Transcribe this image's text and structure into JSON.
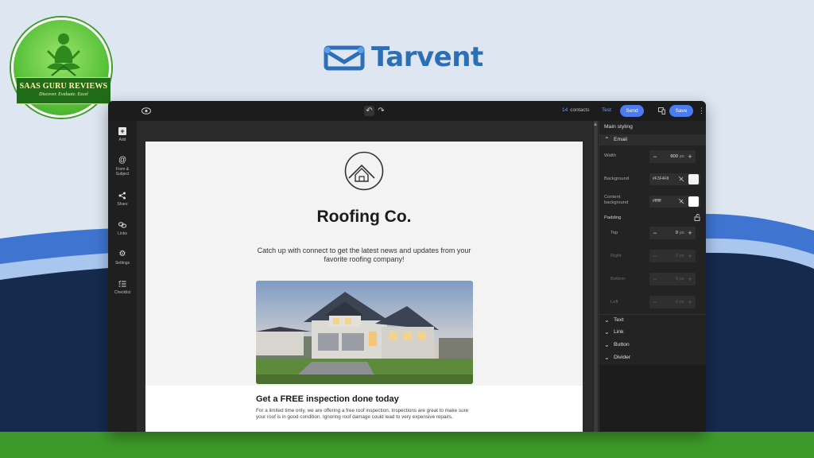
{
  "badge": {
    "title": "SAAS GURU REVIEWS",
    "tagline": "Discover. Evaluate. Excel"
  },
  "brand": {
    "name": "Tarvent"
  },
  "topbar": {
    "contacts_count": "14",
    "contacts_label": "contacts",
    "test_label": "Test",
    "send_label": "Send",
    "save_label": "Save"
  },
  "rail": {
    "items": [
      {
        "label": "Add",
        "icon": "plus-icon"
      },
      {
        "label": "From &",
        "label2": "Subject",
        "icon": "at-icon"
      },
      {
        "label": "Share",
        "icon": "share-icon"
      },
      {
        "label": "Links",
        "icon": "link-icon"
      },
      {
        "label": "Settings",
        "icon": "gear-icon"
      },
      {
        "label": "Checklist",
        "icon": "checklist-icon"
      }
    ]
  },
  "email": {
    "title": "Roofing Co.",
    "intro": "Catch up with connect to get the latest news and updates from your favorite roofing company!",
    "heading": "Get a FREE inspection done today",
    "body": "For a limited time only, we are offering a free roof inspection. Inspections are great to make sure your roof is in good condition. Ignoring roof damage could lead to very expensive repairs."
  },
  "panel": {
    "main_styling": "Main styling",
    "email_section": "Email",
    "width_label": "Width",
    "width_value": "600",
    "unit": "px",
    "background_label": "Background",
    "background_value": "#F3F4F8",
    "content_bg_label": "Content",
    "content_bg_label2": "background",
    "content_bg_value": "#ffffff",
    "padding_label": "Padding",
    "top_label": "Top",
    "top_value": "0",
    "right_label": "Right",
    "right_value": "0",
    "bottom_label": "Bottom",
    "bottom_value": "0",
    "left_label": "Left",
    "left_value": "0",
    "sections": [
      "Text",
      "Link",
      "Button",
      "Divider"
    ]
  },
  "colors": {
    "brand_blue": "#2d6fb7",
    "accent_blue": "#4a7cf0",
    "band_green": "#3d9a2a",
    "navy": "#152a4d"
  }
}
